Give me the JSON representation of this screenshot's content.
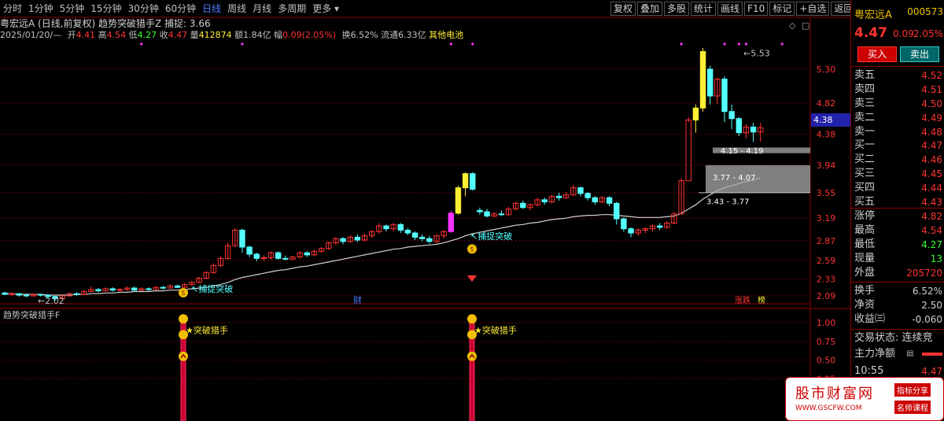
{
  "toolbar": {
    "periods": [
      "分时",
      "1分钟",
      "5分钟",
      "15分钟",
      "30分钟",
      "60分钟",
      "日线",
      "周线",
      "月线",
      "多周期",
      "更多"
    ],
    "active_period": "日线",
    "tools": [
      "复权",
      "叠加",
      "多股",
      "统计",
      "画线",
      "F10",
      "标记",
      "+自选",
      "返回"
    ]
  },
  "info": {
    "line1": "粤宏远A (日线,前复权)  趋势突破猎手Z  捕捉: 3.66",
    "date": "2025/01/20/—",
    "open_label": "开",
    "open": "4.41",
    "high_label": "高",
    "high": "4.54",
    "low_label": "低",
    "low": "4.27",
    "close_label": "收",
    "close": "4.47",
    "vol_label": "量",
    "vol": "412874",
    "amt_label": "额",
    "amt": "1.84亿",
    "range_label": "幅",
    "range": "0.09(2.05%)",
    "turn_label": "换",
    "turn": "6.52%",
    "float_label": "流通",
    "float": "6.33亿",
    "sector": "其他电池"
  },
  "sub_chart": {
    "title": "趋势突破猎手F"
  },
  "chart_data": {
    "type": "candlestick",
    "y_ticks": [
      "5.30",
      "4.82",
      "4.38",
      "3.94",
      "3.55",
      "3.19",
      "2.87",
      "2.59",
      "2.33",
      "2.09"
    ],
    "y_ticks_values": [
      5.3,
      4.82,
      4.38,
      3.94,
      3.55,
      3.19,
      2.87,
      2.59,
      2.33,
      2.09
    ],
    "sub_y_ticks": [
      "1.00",
      "0.75",
      "0.50",
      "0.25"
    ],
    "ylim": [
      2.0,
      5.7
    ],
    "current_price_tag": "4.38",
    "annotations": {
      "low_point": "2.02",
      "high_point": "5.53",
      "breakout_label": "捕捉突破",
      "hunter_label": "突破猎手",
      "zone1": "4.15 - 4.19",
      "zone2": "3.77 - 4.07",
      "zone3": "3.43 - 3.77",
      "finance_mark": "财",
      "tag_rise_fall": "涨跌",
      "tag_bang": "榜"
    },
    "candles": [
      [
        2.13,
        2.11,
        2.15,
        2.1
      ],
      [
        2.11,
        2.12,
        2.14,
        2.09
      ],
      [
        2.12,
        2.1,
        2.13,
        2.08
      ],
      [
        2.1,
        2.09,
        2.12,
        2.07
      ],
      [
        2.09,
        2.11,
        2.13,
        2.08
      ],
      [
        2.11,
        2.1,
        2.12,
        2.08
      ],
      [
        2.1,
        2.08,
        2.11,
        2.05
      ],
      [
        2.08,
        2.05,
        2.09,
        2.02
      ],
      [
        2.05,
        2.09,
        2.1,
        2.04
      ],
      [
        2.09,
        2.12,
        2.14,
        2.08
      ],
      [
        2.12,
        2.11,
        2.14,
        2.09
      ],
      [
        2.11,
        2.15,
        2.17,
        2.1
      ],
      [
        2.15,
        2.18,
        2.22,
        2.14
      ],
      [
        2.18,
        2.16,
        2.2,
        2.14
      ],
      [
        2.16,
        2.19,
        2.21,
        2.15
      ],
      [
        2.19,
        2.17,
        2.21,
        2.15
      ],
      [
        2.17,
        2.18,
        2.2,
        2.15
      ],
      [
        2.18,
        2.2,
        2.22,
        2.16
      ],
      [
        2.2,
        2.17,
        2.22,
        2.16
      ],
      [
        2.17,
        2.19,
        2.21,
        2.16
      ],
      [
        2.19,
        2.18,
        2.21,
        2.16
      ],
      [
        2.18,
        2.21,
        2.23,
        2.17
      ],
      [
        2.21,
        2.2,
        2.23,
        2.18
      ],
      [
        2.2,
        2.23,
        2.25,
        2.19
      ],
      [
        2.23,
        2.21,
        2.25,
        2.2
      ],
      [
        2.21,
        2.25,
        2.27,
        2.2
      ],
      [
        2.25,
        2.28,
        2.3,
        2.23
      ],
      [
        2.28,
        2.34,
        2.36,
        2.27
      ],
      [
        2.34,
        2.42,
        2.44,
        2.32
      ],
      [
        2.42,
        2.52,
        2.55,
        2.4
      ],
      [
        2.52,
        2.62,
        2.65,
        2.5
      ],
      [
        2.62,
        2.8,
        2.85,
        2.6
      ],
      [
        2.8,
        3.02,
        3.05,
        2.78
      ],
      [
        3.02,
        2.78,
        3.04,
        2.7
      ],
      [
        2.78,
        2.68,
        2.8,
        2.64
      ],
      [
        2.68,
        2.62,
        2.7,
        2.58
      ],
      [
        2.62,
        2.63,
        2.66,
        2.58
      ],
      [
        2.63,
        2.7,
        2.72,
        2.6
      ],
      [
        2.7,
        2.62,
        2.72,
        2.6
      ],
      [
        2.62,
        2.61,
        2.66,
        2.59
      ],
      [
        2.61,
        2.64,
        2.66,
        2.6
      ],
      [
        2.64,
        2.7,
        2.72,
        2.62
      ],
      [
        2.7,
        2.67,
        2.72,
        2.64
      ],
      [
        2.67,
        2.72,
        2.75,
        2.65
      ],
      [
        2.72,
        2.76,
        2.78,
        2.7
      ],
      [
        2.76,
        2.84,
        2.86,
        2.74
      ],
      [
        2.84,
        2.9,
        2.92,
        2.81
      ],
      [
        2.9,
        2.86,
        2.92,
        2.82
      ],
      [
        2.86,
        2.92,
        2.95,
        2.84
      ],
      [
        2.92,
        2.88,
        2.96,
        2.85
      ],
      [
        2.88,
        2.94,
        2.97,
        2.86
      ],
      [
        2.94,
        3.0,
        3.02,
        2.91
      ],
      [
        3.0,
        3.08,
        3.12,
        2.97
      ],
      [
        3.08,
        3.04,
        3.1,
        3.0
      ],
      [
        3.04,
        3.1,
        3.12,
        3.0
      ],
      [
        3.1,
        3.02,
        3.12,
        2.98
      ],
      [
        3.02,
        2.98,
        3.05,
        2.95
      ],
      [
        2.98,
        2.92,
        3.0,
        2.88
      ],
      [
        2.92,
        2.9,
        2.96,
        2.86
      ],
      [
        2.9,
        2.86,
        2.94,
        2.83
      ],
      [
        2.86,
        2.94,
        2.96,
        2.84
      ],
      [
        2.94,
        3.0,
        3.02,
        2.9
      ],
      [
        3.0,
        3.26,
        3.3,
        2.98
      ],
      [
        3.26,
        3.62,
        3.65,
        3.24
      ],
      [
        3.62,
        3.82,
        3.84,
        3.5
      ],
      [
        3.82,
        3.6,
        3.84,
        3.58
      ],
      [
        3.3,
        3.28,
        3.34,
        3.24
      ],
      [
        3.28,
        3.22,
        3.32,
        3.2
      ],
      [
        3.22,
        3.25,
        3.28,
        3.2
      ],
      [
        3.25,
        3.24,
        3.3,
        3.22
      ],
      [
        3.24,
        3.32,
        3.35,
        3.22
      ],
      [
        3.32,
        3.4,
        3.42,
        3.3
      ],
      [
        3.4,
        3.34,
        3.44,
        3.32
      ],
      [
        3.34,
        3.38,
        3.4,
        3.3
      ],
      [
        3.38,
        3.45,
        3.48,
        3.36
      ],
      [
        3.45,
        3.42,
        3.48,
        3.38
      ],
      [
        3.42,
        3.5,
        3.52,
        3.4
      ],
      [
        3.5,
        3.48,
        3.55,
        3.44
      ],
      [
        3.48,
        3.52,
        3.56,
        3.46
      ],
      [
        3.52,
        3.62,
        3.66,
        3.5
      ],
      [
        3.62,
        3.54,
        3.64,
        3.5
      ],
      [
        3.54,
        3.48,
        3.56,
        3.44
      ],
      [
        3.48,
        3.42,
        3.5,
        3.38
      ],
      [
        3.42,
        3.48,
        3.5,
        3.4
      ],
      [
        3.48,
        3.4,
        3.5,
        3.36
      ],
      [
        3.4,
        3.18,
        3.42,
        3.1
      ],
      [
        3.18,
        3.04,
        3.2,
        3.0
      ],
      [
        3.04,
        2.98,
        3.06,
        2.92
      ],
      [
        2.98,
        3.02,
        3.05,
        2.94
      ],
      [
        3.02,
        3.04,
        3.06,
        2.98
      ],
      [
        3.04,
        3.08,
        3.1,
        3.0
      ],
      [
        3.08,
        3.06,
        3.12,
        3.02
      ],
      [
        3.06,
        3.12,
        3.15,
        3.04
      ],
      [
        3.12,
        3.25,
        3.28,
        3.1
      ],
      [
        3.25,
        3.72,
        3.76,
        3.24
      ],
      [
        3.72,
        4.58,
        4.62,
        4.55
      ],
      [
        4.58,
        4.75,
        4.8,
        4.4
      ],
      [
        4.75,
        5.55,
        5.6,
        4.7
      ],
      [
        5.3,
        4.92,
        5.35,
        4.8
      ],
      [
        4.92,
        5.16,
        5.18,
        4.8
      ],
      [
        5.16,
        4.7,
        5.2,
        4.55
      ],
      [
        4.7,
        4.6,
        4.8,
        4.45
      ],
      [
        4.6,
        4.4,
        4.62,
        4.35
      ],
      [
        4.4,
        4.48,
        4.52,
        4.32
      ],
      [
        4.48,
        4.41,
        4.54,
        4.27
      ],
      [
        4.41,
        4.47,
        4.54,
        4.27
      ]
    ],
    "ma": [
      2.12,
      2.12,
      2.11,
      2.11,
      2.11,
      2.11,
      2.1,
      2.1,
      2.1,
      2.1,
      2.11,
      2.11,
      2.12,
      2.12,
      2.13,
      2.13,
      2.14,
      2.14,
      2.15,
      2.15,
      2.15,
      2.16,
      2.16,
      2.17,
      2.17,
      2.18,
      2.19,
      2.2,
      2.21,
      2.23,
      2.25,
      2.28,
      2.32,
      2.35,
      2.37,
      2.39,
      2.41,
      2.43,
      2.45,
      2.46,
      2.48,
      2.5,
      2.51,
      2.53,
      2.55,
      2.57,
      2.59,
      2.61,
      2.63,
      2.65,
      2.67,
      2.69,
      2.71,
      2.73,
      2.75,
      2.76,
      2.78,
      2.79,
      2.8,
      2.81,
      2.82,
      2.84,
      2.87,
      2.9,
      2.94,
      2.97,
      2.99,
      3.01,
      3.03,
      3.05,
      3.07,
      3.09,
      3.1,
      3.12,
      3.13,
      3.15,
      3.17,
      3.18,
      3.19,
      3.21,
      3.22,
      3.23,
      3.23,
      3.24,
      3.24,
      3.23,
      3.22,
      3.21,
      3.2,
      3.2,
      3.2,
      3.2,
      3.21,
      3.22,
      3.26,
      3.32,
      3.38,
      3.46,
      3.52,
      3.58,
      3.62,
      3.65,
      3.68,
      3.71,
      3.73,
      3.76
    ]
  },
  "right_panel": {
    "stock_name": "粤宏远A",
    "code": "000573",
    "price": "4.47",
    "change": "0.09",
    "pct": "2.05%",
    "buy_btn": "买入",
    "sell_btn": "卖出",
    "asks": [
      {
        "label": "卖五",
        "price": "4.52"
      },
      {
        "label": "卖四",
        "price": "4.51"
      },
      {
        "label": "卖三",
        "price": "4.50"
      },
      {
        "label": "卖二",
        "price": "4.49"
      },
      {
        "label": "卖一",
        "price": "4.48"
      }
    ],
    "bids": [
      {
        "label": "买一",
        "price": "4.47"
      },
      {
        "label": "买二",
        "price": "4.46"
      },
      {
        "label": "买三",
        "price": "4.45"
      },
      {
        "label": "买四",
        "price": "4.44"
      },
      {
        "label": "买五",
        "price": "4.43"
      }
    ],
    "stats": [
      {
        "label": "涨停",
        "value": "4.82"
      },
      {
        "label": "最高",
        "value": "4.54"
      },
      {
        "label": "最低",
        "value": "4.27"
      },
      {
        "label": "现量",
        "value": "13"
      },
      {
        "label": "外盘",
        "value": "205720"
      }
    ],
    "stats2": [
      {
        "label": "换手",
        "value": "6.52%"
      },
      {
        "label": "净资",
        "value": "2.50"
      },
      {
        "label": "收益㈢",
        "value": "-0.060"
      }
    ],
    "status": "交易状态: 连续竞",
    "main_flow": "主力净额",
    "time": "10:55",
    "time_price": "4.47"
  },
  "watermark": {
    "title": "股市财富网",
    "url": "WWW.GSCFW.COM",
    "tag1": "指标分享",
    "tag2": "名师课程"
  },
  "colors": {
    "up": "#ff3333",
    "down": "#54ffff",
    "ma": "#d0d0d0",
    "highlight": "#ffee33",
    "magenta": "#ff33ff",
    "zone": "#aaaaaa"
  }
}
